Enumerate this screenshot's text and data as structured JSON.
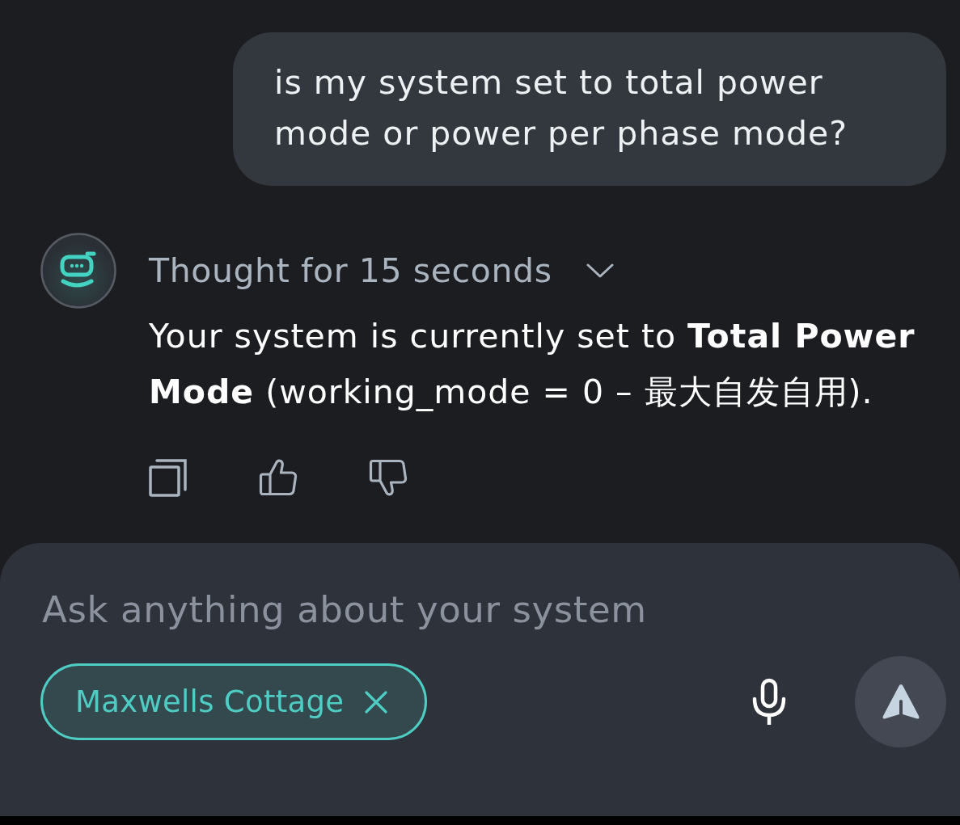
{
  "messages": [
    {
      "kind": "user",
      "text": "is my system set to total power mode or power per phase mode?"
    },
    {
      "kind": "assistant",
      "thought": {
        "label": "Thought for 15 seconds",
        "expanded": false
      },
      "text": "Your system is currently set to **Total Power Mode** (working_mode = 0 – 最大自发自用)."
    }
  ],
  "composer": {
    "placeholder": "Ask anything about your system",
    "chips": [
      {
        "label": "Maxwells Cottage"
      }
    ]
  }
}
